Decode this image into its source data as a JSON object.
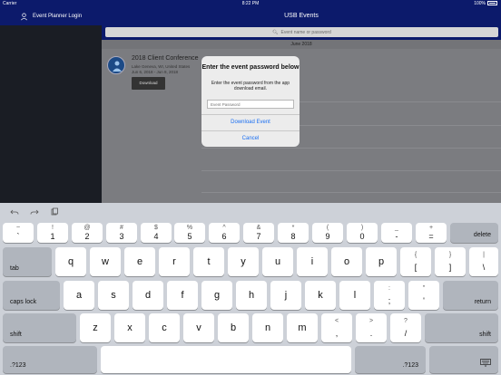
{
  "status": {
    "carrier": "Carrier",
    "time": "8:22 PM",
    "battery": "100%"
  },
  "sidebar": {
    "title": "Event Planner Login"
  },
  "nav": {
    "title": "USB Events"
  },
  "search": {
    "placeholder": "Event name or password"
  },
  "events": {
    "section": "June 2018",
    "item": {
      "title": "2018 Client Conference",
      "location": "Lake Geneva, WI, United States",
      "dates": "Jun 6, 2018 - Jun 8, 2018",
      "download_label": "Download"
    }
  },
  "modal": {
    "title": "Enter the event password below",
    "message": "Enter the event password from the app download email.",
    "input_placeholder": "Event Password",
    "download_label": "Download Event",
    "cancel_label": "Cancel"
  },
  "keyboard": {
    "tools": [
      "undo-icon",
      "redo-icon",
      "paste-icon"
    ],
    "number_row": [
      {
        "top": "~",
        "bot": "`"
      },
      {
        "top": "!",
        "bot": "1"
      },
      {
        "top": "@",
        "bot": "2"
      },
      {
        "top": "#",
        "bot": "3"
      },
      {
        "top": "$",
        "bot": "4"
      },
      {
        "top": "%",
        "bot": "5"
      },
      {
        "top": "^",
        "bot": "6"
      },
      {
        "top": "&",
        "bot": "7"
      },
      {
        "top": "*",
        "bot": "8"
      },
      {
        "top": "(",
        "bot": "9"
      },
      {
        "top": ")",
        "bot": "0"
      },
      {
        "top": "_",
        "bot": "-"
      },
      {
        "top": "+",
        "bot": "="
      }
    ],
    "delete": "delete",
    "tab": "tab",
    "row_q": [
      "q",
      "w",
      "e",
      "r",
      "t",
      "y",
      "u",
      "i",
      "o",
      "p"
    ],
    "row_q_sym": [
      {
        "top": "{",
        "bot": "["
      },
      {
        "top": "}",
        "bot": "]"
      },
      {
        "top": "|",
        "bot": "\\"
      }
    ],
    "caps": "caps lock",
    "row_a": [
      "a",
      "s",
      "d",
      "f",
      "g",
      "h",
      "j",
      "k",
      "l"
    ],
    "row_a_sym": [
      {
        "top": ":",
        "bot": ";"
      },
      {
        "top": "\"",
        "bot": "'"
      }
    ],
    "return": "return",
    "shift": "shift",
    "row_z": [
      "z",
      "x",
      "c",
      "v",
      "b",
      "n",
      "m"
    ],
    "row_z_sym": [
      {
        "top": "<",
        "bot": ","
      },
      {
        "top": ">",
        "bot": "."
      },
      {
        "top": "?",
        "bot": "/"
      }
    ],
    "numbers": ".?123"
  }
}
